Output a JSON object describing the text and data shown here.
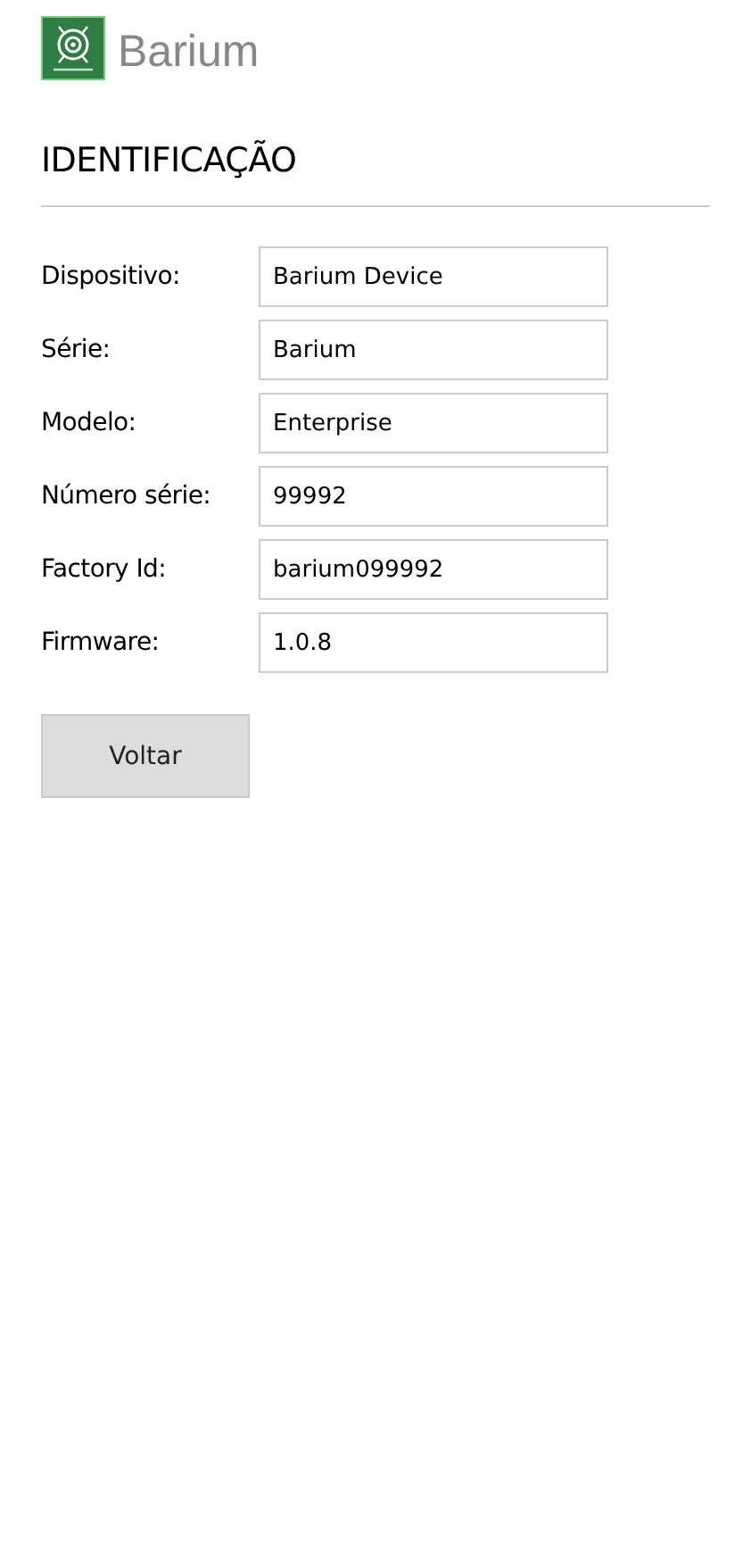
{
  "header": {
    "brand": "Barium"
  },
  "section": {
    "title": "IDENTIFICAÇÃO"
  },
  "fields": [
    {
      "label": "Dispositivo:",
      "value": "Barium Device"
    },
    {
      "label": "Série:",
      "value": "Barium"
    },
    {
      "label": "Modelo:",
      "value": "Enterprise"
    },
    {
      "label": "Número série:",
      "value": "99992"
    },
    {
      "label": "Factory Id:",
      "value": "barium099992"
    },
    {
      "label": "Firmware:",
      "value": "1.0.8"
    }
  ],
  "buttons": [
    {
      "label": "Voltar"
    }
  ]
}
